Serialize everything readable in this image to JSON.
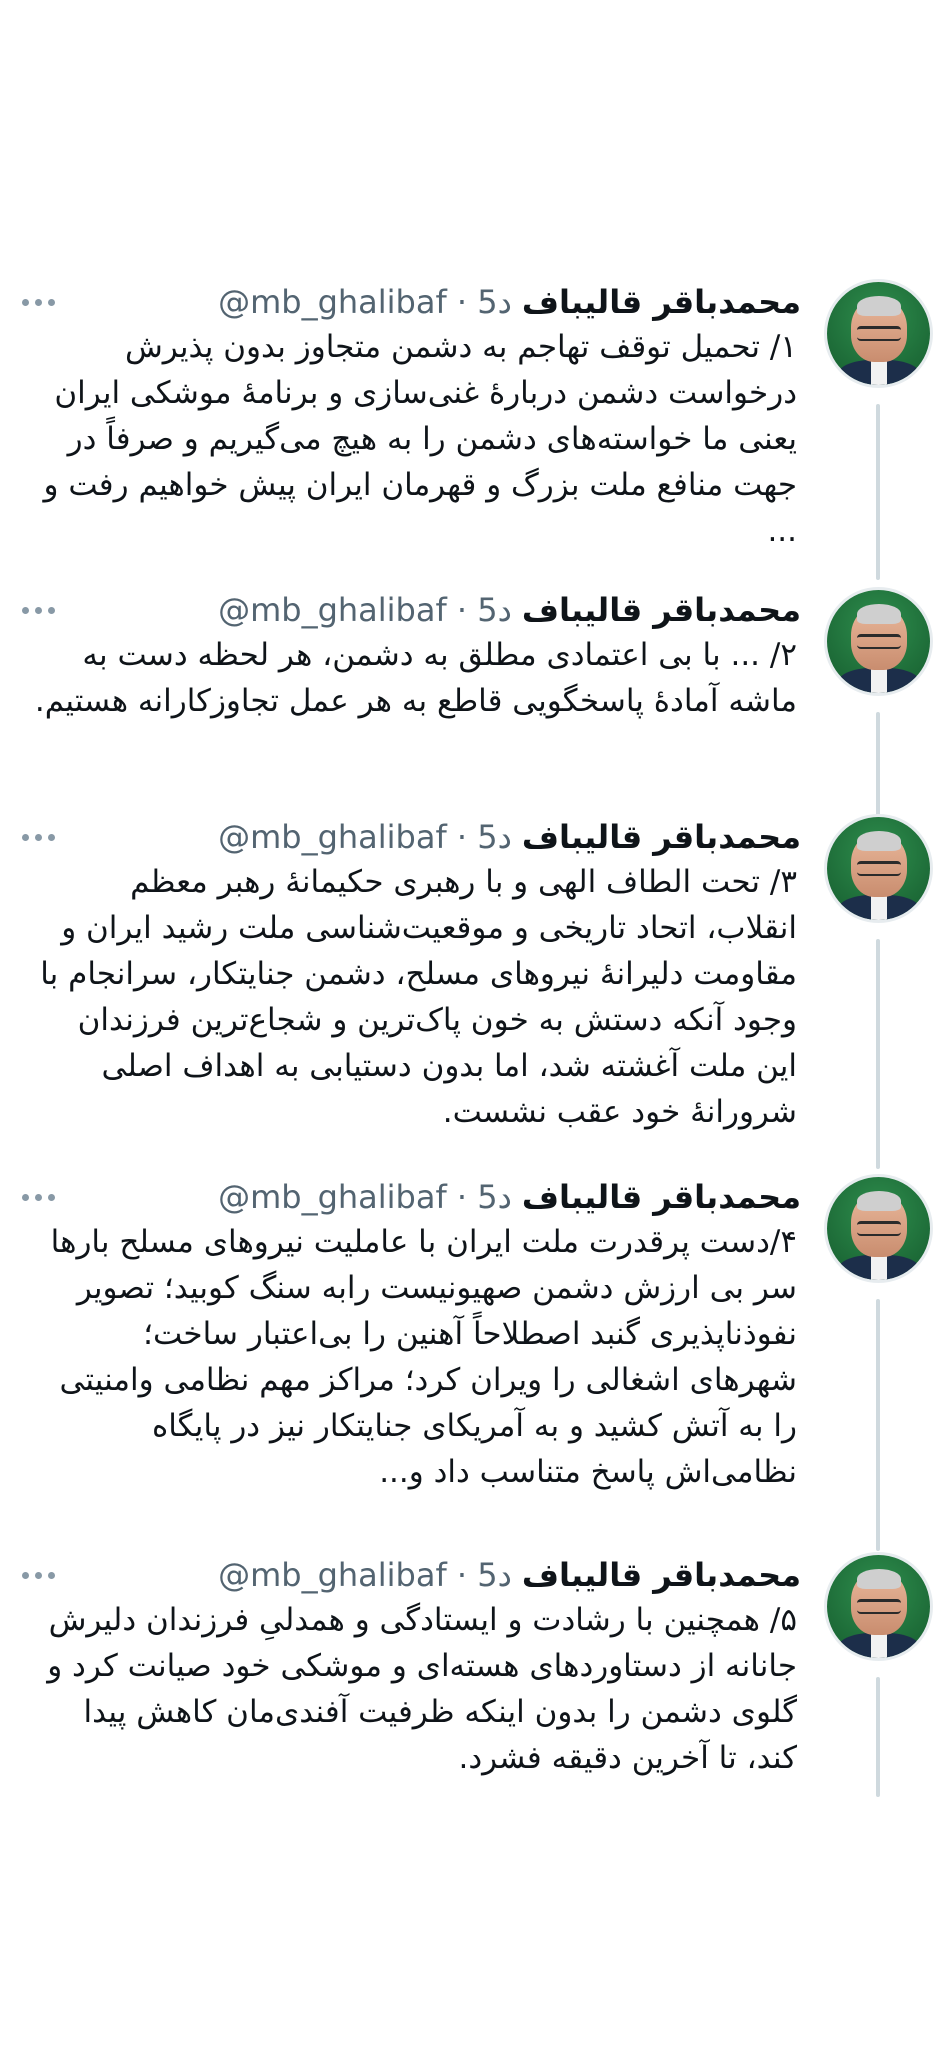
{
  "tweets": [
    {
      "name": "محمدباقر قالیباف",
      "meta": "@mb_ghalibaf · 5د",
      "text": "۱/ تحمیل توقف تهاجم به دشمن متجاوز بدون پذیرش درخواست دشمن دربارهٔ غنی‌سازی و برنامهٔ موشکی ایران یعنی ما خواسته‌های دشمن را به هیچ می‌گیریم و صرفاً در جهت منافع ملت بزرگ و قهرمان ایران پیش خواهیم رفت و ..."
    },
    {
      "name": "محمدباقر قالیباف",
      "meta": "@mb_ghalibaf · 5د",
      "text": "۲/ ... با بی اعتمادی مطلق به دشمن، هر لحظه دست به ماشه آمادهٔ پاسخگویی قاطع به هر عمل تجاوزکارانه هستیم."
    },
    {
      "name": "محمدباقر قالیباف",
      "meta": "@mb_ghalibaf · 5د",
      "text": "۳/ تحت الطاف الهی و با رهبری حکیمانهٔ رهبر معظم انقلاب، اتحاد تاریخی و موقعیت‌شناسی ملت رشید ایران و مقاومت دلیرانهٔ نیروهای مسلح، دشمن جنایتکار، سرانجام با وجود آنکه دستش به خون پاک‌ترین و شجاع‌ترین فرزندان این ملت آغشته شد، اما بدون دستیابی به اهداف اصلی شرورانهٔ خود عقب نشست."
    },
    {
      "name": "محمدباقر قالیباف",
      "meta": "@mb_ghalibaf · 5د",
      "text": "۴/دست پرقدرت ملت ایران با عاملیت نیروهای مسلح بارها سر بی ارزش دشمن صهیونیست رابه سنگ کوبید؛ تصویر نفوذناپذیری گنبد اصطلاحاً آهنین را بی‌اعتبار ساخت؛ شهرهای اشغالی را ویران کرد؛ مراکز مهم نظامی وامنیتی را به آتش کشید و به آمریکای جنایتکار نیز در پایگاه نظامی‌اش پاسخ متناسب داد و..."
    },
    {
      "name": "محمدباقر قالیباف",
      "meta": "@mb_ghalibaf · 5د",
      "text": "۵/ همچنین با رشادت و ایستادگی و همدلیِ فرزندان دلیرش جانانه از دستاوردهای هسته‌ای و موشکی خود صیانت کرد و گلوی دشمن را بدون اینکه ظرفیت آفندی‌مان کاهش پیدا کند، تا آخرین دقیقه فشرد."
    }
  ]
}
